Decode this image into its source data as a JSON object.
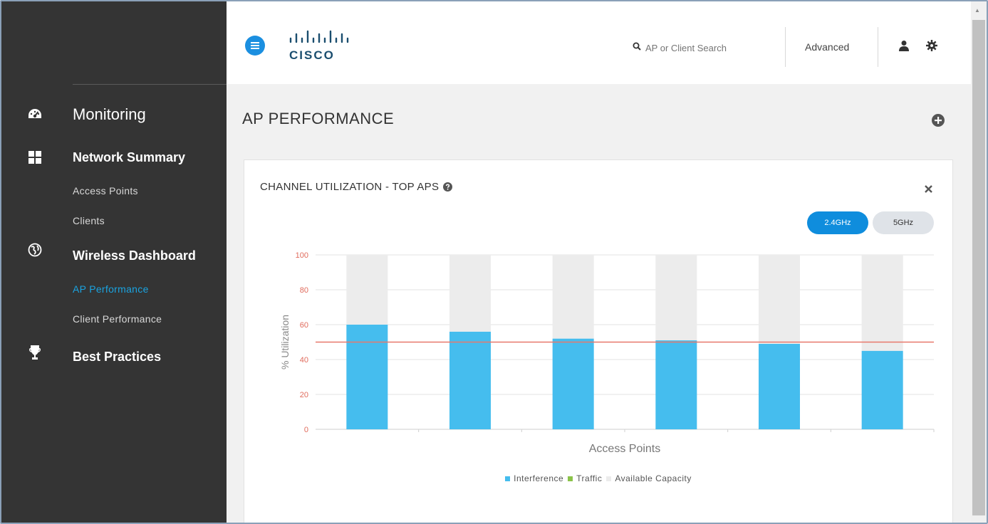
{
  "sidebar": {
    "items": [
      {
        "label": "Monitoring",
        "icon": "dashboard-gauge-icon"
      },
      {
        "label": "Network Summary",
        "icon": "grid-icon"
      },
      {
        "label": "Access Points"
      },
      {
        "label": "Clients"
      },
      {
        "label": "Wireless Dashboard",
        "icon": "globe-icon"
      },
      {
        "label": "AP Performance",
        "active": true
      },
      {
        "label": "Client Performance"
      },
      {
        "label": "Best Practices",
        "icon": "trophy-icon"
      }
    ],
    "active_color": "#1aa3e0"
  },
  "topbar": {
    "logo_text": "CISCO",
    "search_placeholder": "AP or Client Search",
    "advanced_label": "Advanced",
    "accent_color": "#1b8fe0"
  },
  "page": {
    "title": "AP PERFORMANCE"
  },
  "card": {
    "title": "CHANNEL UTILIZATION - TOP APS",
    "bands": [
      {
        "label": "2.4GHz",
        "selected": true
      },
      {
        "label": "5GHz",
        "selected": false
      }
    ]
  },
  "chart_data": {
    "type": "bar",
    "stacked": true,
    "xlabel": "Access Points",
    "ylabel": "% Utilization",
    "ylim": [
      0,
      100
    ],
    "yticks": [
      0,
      20,
      40,
      60,
      80,
      100
    ],
    "categories": [
      "",
      "",
      "",
      "",
      "",
      ""
    ],
    "series": [
      {
        "name": "Interference",
        "color": "#45bdee",
        "values": [
          60,
          56,
          52,
          51,
          49,
          45
        ]
      },
      {
        "name": "Traffic",
        "color": "#8bc34a",
        "values": [
          0,
          0,
          0,
          0,
          0,
          0
        ]
      },
      {
        "name": "Available Capacity",
        "color": "#ececec",
        "values": [
          40,
          44,
          48,
          49,
          51,
          55
        ]
      }
    ],
    "threshold": {
      "value": 50,
      "color": "#e8786b"
    },
    "grid": true,
    "legend_position": "bottom"
  }
}
